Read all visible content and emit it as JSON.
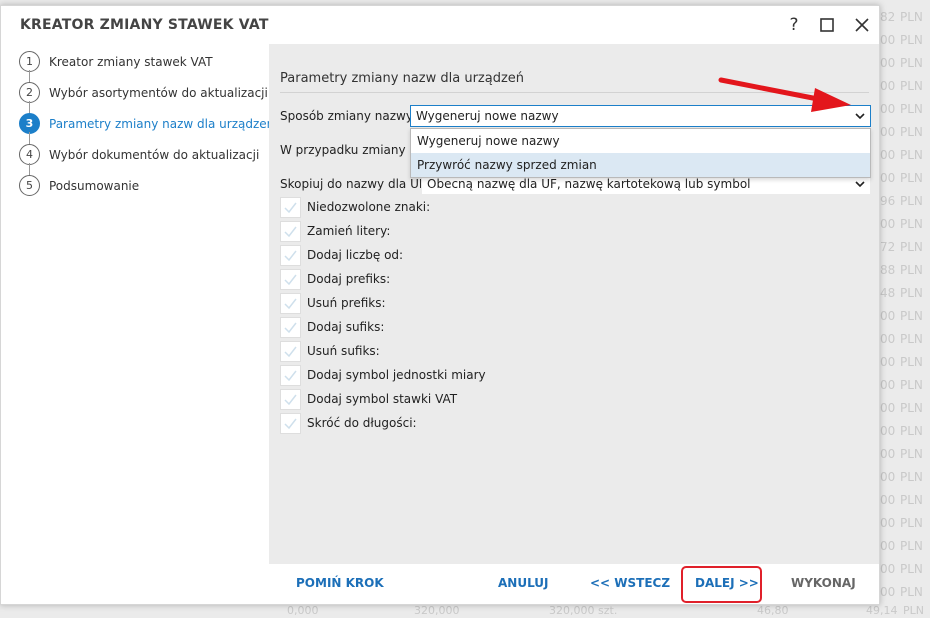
{
  "dialog": {
    "title": "KREATOR ZMIANY STAWEK VAT",
    "help_label": "?"
  },
  "steps": [
    {
      "num": "1",
      "label": "Kreator zmiany stawek VAT",
      "active": false
    },
    {
      "num": "2",
      "label": "Wybór asortymentów do aktualizacji",
      "active": false
    },
    {
      "num": "3",
      "label": "Parametry zmiany nazw dla urządzeń",
      "active": true
    },
    {
      "num": "4",
      "label": "Wybór dokumentów do aktualizacji",
      "active": false
    },
    {
      "num": "5",
      "label": "Podsumowanie",
      "active": false
    }
  ],
  "content": {
    "section_title": "Parametry zmiany nazw dla urządzeń",
    "rename_method_label": "Sposób zmiany nazwy:",
    "rename_method_value": "Wygeneruj nowe nazwy",
    "dropdown_options": [
      "Wygeneruj nowe nazwy",
      "Przywróć nazwy sprzed zmian"
    ],
    "in_case_label": "W przypadku zmiany nazw",
    "copy_label": "Skopiuj do nazwy dla UF:",
    "copy_value": "Obecną nazwę dla UF, nazwę kartotekową lub symbol",
    "checkboxes": [
      "Niedozwolone znaki:",
      "Zamień litery:",
      "Dodaj liczbę od:",
      "Dodaj prefiks:",
      "Usuń prefiks:",
      "Dodaj sufiks:",
      "Usuń sufiks:",
      "Dodaj symbol jednostki miary",
      "Dodaj symbol stawki VAT",
      "Skróć do długości:"
    ]
  },
  "footer": {
    "skip": "POMIŃ KROK",
    "cancel": "ANULUJ",
    "back": "<< WSTECZ",
    "next": "DALEJ >>",
    "finish": "WYKONAJ"
  },
  "background": {
    "rows": [
      {
        "num": "82",
        "unit": "PLN"
      },
      {
        "num": "00",
        "unit": "PLN"
      },
      {
        "num": "00",
        "unit": "PLN"
      },
      {
        "num": "00",
        "unit": "PLN"
      },
      {
        "num": "00",
        "unit": "PLN"
      },
      {
        "num": "00",
        "unit": "PLN"
      },
      {
        "num": "00",
        "unit": "PLN"
      },
      {
        "num": "00",
        "unit": "PLN"
      },
      {
        "num": "96",
        "unit": "PLN"
      },
      {
        "num": "00",
        "unit": "PLN"
      },
      {
        "num": "72",
        "unit": "PLN"
      },
      {
        "num": "88",
        "unit": "PLN"
      },
      {
        "num": "48",
        "unit": "PLN"
      },
      {
        "num": "00",
        "unit": "PLN"
      },
      {
        "num": "00",
        "unit": "PLN"
      },
      {
        "num": "00",
        "unit": "PLN"
      },
      {
        "num": "00",
        "unit": "PLN"
      },
      {
        "num": "00",
        "unit": "PLN"
      },
      {
        "num": "00",
        "unit": "PLN"
      },
      {
        "num": "00",
        "unit": "PLN"
      },
      {
        "num": "00",
        "unit": "PLN"
      },
      {
        "num": "00",
        "unit": "PLN"
      },
      {
        "num": "00",
        "unit": "PLN"
      },
      {
        "num": "00",
        "unit": "PLN"
      },
      {
        "num": "00",
        "unit": "PLN"
      },
      {
        "num": "00",
        "unit": "PLN"
      }
    ],
    "bottom_row": [
      "0,000",
      "320,000",
      "320,000",
      "szt.",
      "46,80",
      "49,14",
      "PLN"
    ]
  },
  "colors": {
    "accent": "#1c7fc9",
    "link": "#1c6fb8",
    "highlight_box": "#e0202a",
    "arrow": "#e3161c",
    "dropdown_hover": "#dbe8f3"
  }
}
